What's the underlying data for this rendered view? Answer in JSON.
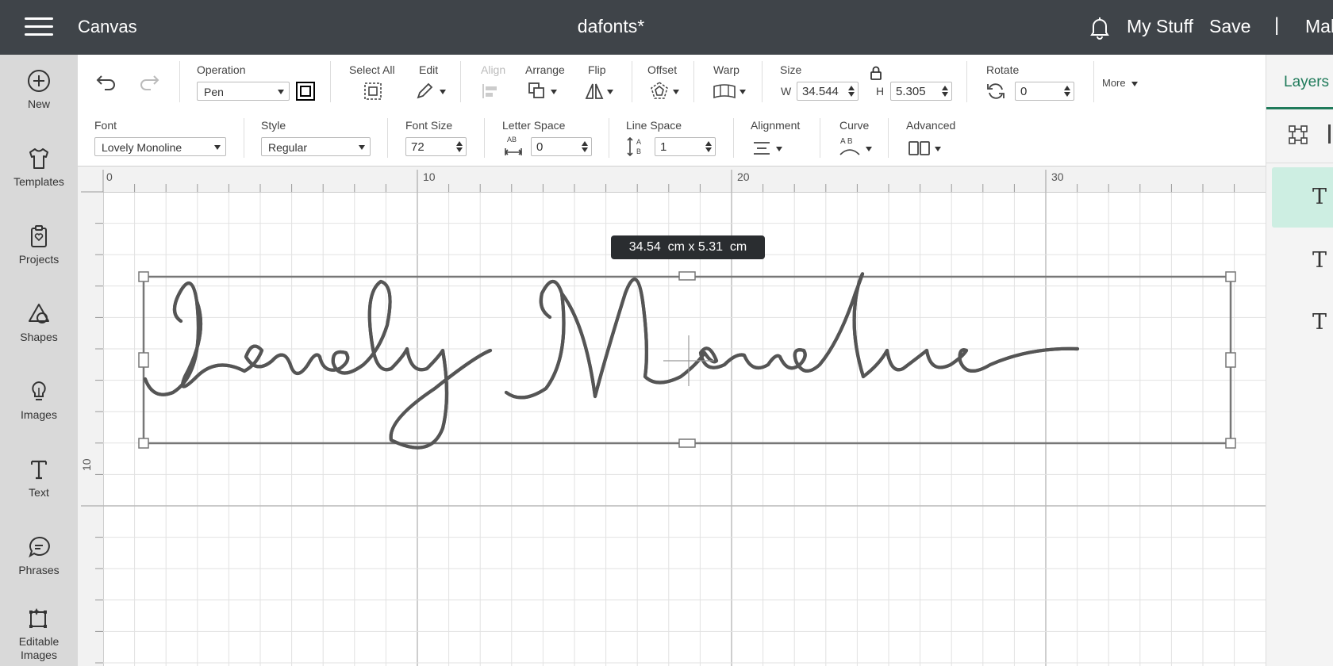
{
  "topbar": {
    "app_title": "Canvas",
    "document_title": "dafonts*",
    "my_stuff": "My Stuff",
    "save": "Save",
    "separator": "|",
    "user_name": "Mal",
    "background": "#3f4449"
  },
  "left_nav": {
    "items": [
      {
        "label": "New",
        "icon": "plus-circle-icon"
      },
      {
        "label": "Templates",
        "icon": "tshirt-icon"
      },
      {
        "label": "Projects",
        "icon": "clipboard-icon"
      },
      {
        "label": "Shapes",
        "icon": "shapes-icon"
      },
      {
        "label": "Images",
        "icon": "lightbulb-icon"
      },
      {
        "label": "Text",
        "icon": "text-icon"
      },
      {
        "label": "Phrases",
        "icon": "speech-bubble-icon"
      },
      {
        "label": "Editable Images",
        "icon": "editable-image-icon"
      }
    ]
  },
  "toolbar": {
    "operation_label": "Operation",
    "operation_value": "Pen",
    "select_all_label": "Select All",
    "edit_label": "Edit",
    "align_label": "Align",
    "arrange_label": "Arrange",
    "flip_label": "Flip",
    "offset_label": "Offset",
    "warp_label": "Warp",
    "size_label": "Size",
    "width_label": "W",
    "width_value": "34.544",
    "height_label": "H",
    "height_value": "5.305",
    "rotate_label": "Rotate",
    "rotate_value": "0",
    "more_label": "More"
  },
  "text_toolbar": {
    "font_label": "Font",
    "font_value": "Lovely Monoline",
    "style_label": "Style",
    "style_value": "Regular",
    "font_size_label": "Font Size",
    "font_size_value": "72",
    "letter_space_label": "Letter Space",
    "letter_space_icon_text": "AB",
    "letter_space_value": "0",
    "line_space_label": "Line Space",
    "line_space_icon_a": "A",
    "line_space_icon_b": "B",
    "line_space_value": "1",
    "alignment_label": "Alignment",
    "curve_label": "Curve",
    "curve_icon_text": "A B",
    "advanced_label": "Advanced"
  },
  "canvas": {
    "ruler_top_labels": [
      "0",
      "10",
      "20",
      "30"
    ],
    "ruler_left_labels": [
      "10"
    ],
    "dimension_tooltip": "34.54  cm x 5.31  cm",
    "text_content": "Lovely Monoline"
  },
  "right_panel": {
    "tab_label": "Layers",
    "layer_glyph": "T",
    "accent_color": "#1f7a5a",
    "selected_row_color": "#cdeee2"
  }
}
